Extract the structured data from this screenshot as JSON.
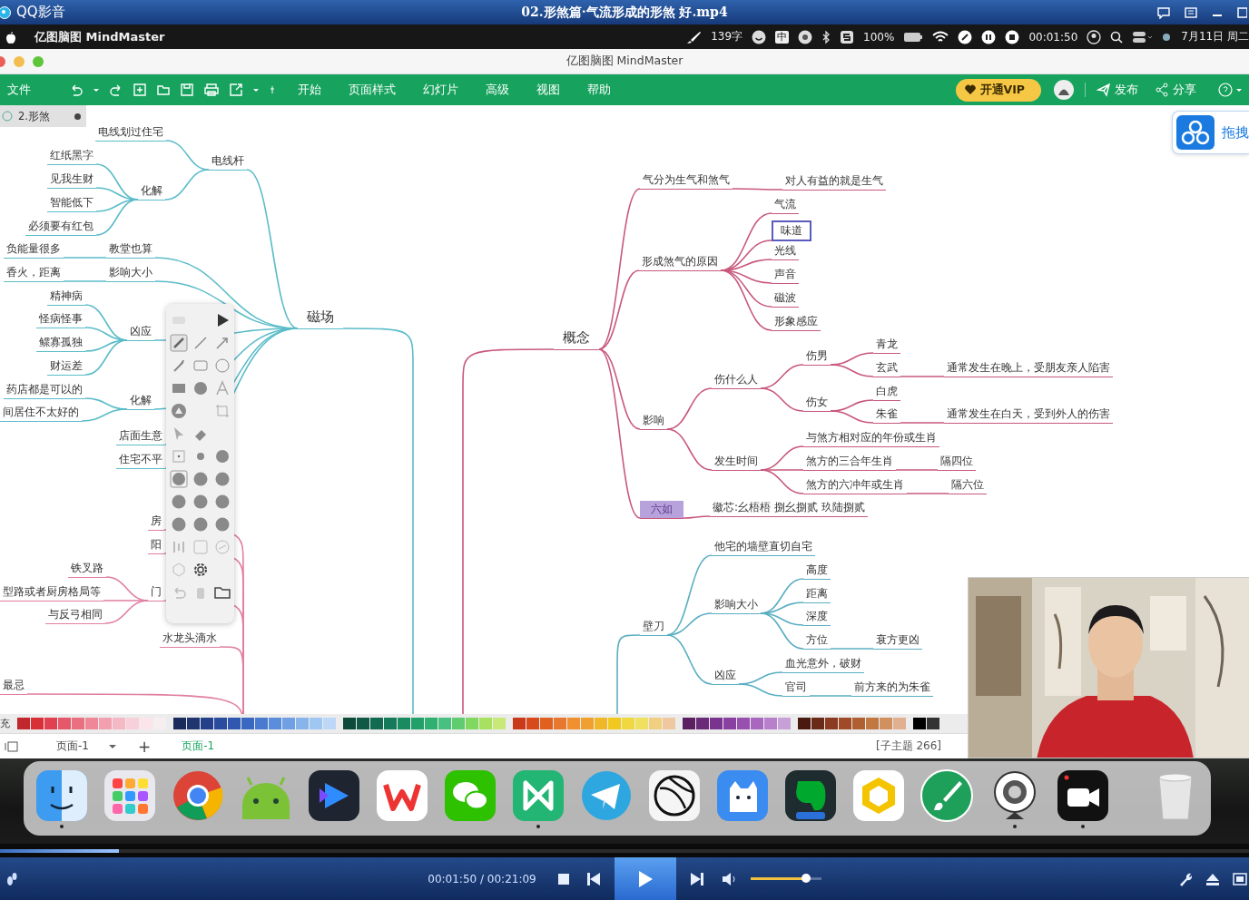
{
  "player_window": {
    "app_name": "QQ影音",
    "title": "02.形煞篇·气流形成的形煞 好.mp4"
  },
  "menu_bar": {
    "app_name": "亿图脑图 MindMaster",
    "word_count": "139字",
    "input_method": "中",
    "battery": "100%",
    "recording_time": "00:01:50",
    "date": "7月11日 周二"
  },
  "window": {
    "title": "亿图脑图 MindMaster"
  },
  "toolbar": {
    "file_menu": "文件",
    "menus": [
      "开始",
      "页面样式",
      "幻灯片",
      "高级",
      "视图",
      "帮助"
    ],
    "vip_button": "开通VIP",
    "publish": "发布",
    "share": "分享"
  },
  "document_tabs": [
    {
      "label": "2.形煞",
      "selected": true
    }
  ],
  "drag_button": {
    "label": "拖拽"
  },
  "mind_map": {
    "branches": [
      {
        "color": "#5bbcc8",
        "topics": [
          {
            "text": "磁场",
            "selected": false,
            "children": [
              {
                "text": "电线杆",
                "selected": false,
                "children": [
                  {
                    "text": "电线划过住宅",
                    "selected": false
                  },
                  {
                    "text": "化解",
                    "selected": false,
                    "children": [
                      {
                        "text": "红纸黑字",
                        "selected": false
                      },
                      {
                        "text": "见我生财",
                        "selected": false
                      },
                      {
                        "text": "智能低下",
                        "selected": false
                      },
                      {
                        "text": "必须要有红包",
                        "selected": false
                      }
                    ]
                  }
                ]
              },
              {
                "text": "教堂也算",
                "selected": false,
                "children": [
                  {
                    "text": "负能量很多",
                    "selected": false
                  }
                ]
              },
              {
                "text": "影响大小",
                "selected": false,
                "children": [
                  {
                    "text": "香火，距离",
                    "selected": false
                  }
                ]
              },
              {
                "text": "凶应",
                "selected": false,
                "children": [
                  {
                    "text": "精神病",
                    "selected": false
                  },
                  {
                    "text": "怪病怪事",
                    "selected": false
                  },
                  {
                    "text": "鳏寡孤独",
                    "selected": false
                  },
                  {
                    "text": "财运差",
                    "selected": false
                  }
                ]
              },
              {
                "text": "化解",
                "selected": false,
                "children": [
                  {
                    "text": "药店都是可以的",
                    "selected": false
                  },
                  {
                    "text": "间居住不太好的",
                    "selected": false
                  }
                ]
              },
              {
                "text": "店面生意",
                "selected": false
              },
              {
                "text": "住宅不平",
                "selected": false
              }
            ]
          }
        ]
      },
      {
        "color": "#e07ea2",
        "topics": [
          {
            "text": "房",
            "selected": false
          },
          {
            "text": "阳",
            "selected": false
          },
          {
            "text": "门",
            "selected": false,
            "children": [
              {
                "text": "铁叉路",
                "selected": false
              },
              {
                "text": "型路或者厨房格局等",
                "selected": false
              },
              {
                "text": "与反弓相同",
                "selected": false
              }
            ]
          },
          {
            "text": "水龙头滴水",
            "selected": false
          },
          {
            "text": "最忌",
            "selected": false
          }
        ]
      },
      {
        "color": "#c8587c",
        "topics": [
          {
            "text": "概念",
            "selected": false,
            "children": [
              {
                "text": "气分为生气和煞气",
                "selected": false,
                "children": [
                  {
                    "text": "对人有益的就是生气",
                    "selected": false
                  }
                ]
              },
              {
                "text": "形成煞气的原因",
                "selected": false,
                "children": [
                  {
                    "text": "气流",
                    "selected": false
                  },
                  {
                    "text": "味道",
                    "selected": true
                  },
                  {
                    "text": "光线",
                    "selected": false
                  },
                  {
                    "text": "声音",
                    "selected": false
                  },
                  {
                    "text": "磁波",
                    "selected": false
                  },
                  {
                    "text": "形象感应",
                    "selected": false
                  }
                ]
              },
              {
                "text": "影响",
                "selected": false,
                "children": [
                  {
                    "text": "伤什么人",
                    "selected": false,
                    "children": [
                      {
                        "text": "伤男",
                        "selected": false,
                        "children": [
                          {
                            "text": "青龙",
                            "selected": false
                          },
                          {
                            "text": "玄武",
                            "selected": false,
                            "children": [
                              {
                                "text": "通常发生在晚上，受朋友亲人陷害",
                                "selected": false
                              }
                            ]
                          }
                        ]
                      },
                      {
                        "text": "伤女",
                        "selected": false,
                        "children": [
                          {
                            "text": "白虎",
                            "selected": false
                          },
                          {
                            "text": "朱雀",
                            "selected": false,
                            "children": [
                              {
                                "text": "通常发生在白天，受到外人的伤害",
                                "selected": false
                              }
                            ]
                          }
                        ]
                      }
                    ]
                  },
                  {
                    "text": "发生时间",
                    "selected": false,
                    "children": [
                      {
                        "text": "与煞方相对应的年份或生肖",
                        "selected": false
                      },
                      {
                        "text": "煞方的三合年生肖",
                        "selected": false,
                        "children": [
                          {
                            "text": "隔四位",
                            "selected": false
                          }
                        ]
                      },
                      {
                        "text": "煞方的六冲年或生肖",
                        "selected": false,
                        "children": [
                          {
                            "text": "隔六位",
                            "selected": false
                          }
                        ]
                      }
                    ]
                  }
                ]
              },
              {
                "text": "六如",
                "selected": false,
                "color": "#b8a2dc",
                "children": [
                  {
                    "text": "徽芯:幺梧梧 捌幺捌贰 玖陆捌贰",
                    "selected": false
                  }
                ]
              }
            ]
          }
        ]
      },
      {
        "color": "#5aaec2",
        "topics": [
          {
            "text": "壁刀",
            "selected": false,
            "children": [
              {
                "text": "他宅的墙壁直切自宅",
                "selected": false
              },
              {
                "text": "影响大小",
                "selected": false,
                "children": [
                  {
                    "text": "高度",
                    "selected": false
                  },
                  {
                    "text": "距离",
                    "selected": false
                  },
                  {
                    "text": "深度",
                    "selected": false
                  },
                  {
                    "text": "方位",
                    "selected": false,
                    "children": [
                      {
                        "text": "衰方更凶",
                        "selected": false
                      }
                    ]
                  }
                ]
              },
              {
                "text": "凶应",
                "selected": false,
                "children": [
                  {
                    "text": "血光意外，破财",
                    "selected": false
                  },
                  {
                    "text": "官司",
                    "selected": false,
                    "children": [
                      {
                        "text": "前方来的为朱雀",
                        "selected": false
                      }
                    ]
                  }
                ]
              }
            ]
          }
        ]
      }
    ]
  },
  "palette": {
    "label": "充"
  },
  "status_bar": {
    "page_dropdown": "页面-1",
    "add_page": "+",
    "pages": [
      {
        "label": "页面-1",
        "selected": true
      }
    ],
    "topic_count": "[子主题 266]"
  },
  "dock": {
    "apps": [
      {
        "running": true
      },
      {
        "running": false
      },
      {
        "running": false
      },
      {
        "running": false
      },
      {
        "running": false
      },
      {
        "running": false
      },
      {
        "running": false
      },
      {
        "running": true
      },
      {
        "running": false
      },
      {
        "running": false
      },
      {
        "running": false
      },
      {
        "running": false
      },
      {
        "running": false
      },
      {
        "running": false
      },
      {
        "running": true
      },
      {
        "running": true
      },
      {
        "running": false
      }
    ]
  },
  "player": {
    "progress": {
      "level": 0.095
    },
    "time": "00:01:50 / 00:21:09",
    "volume": {
      "level": 0.78
    }
  }
}
